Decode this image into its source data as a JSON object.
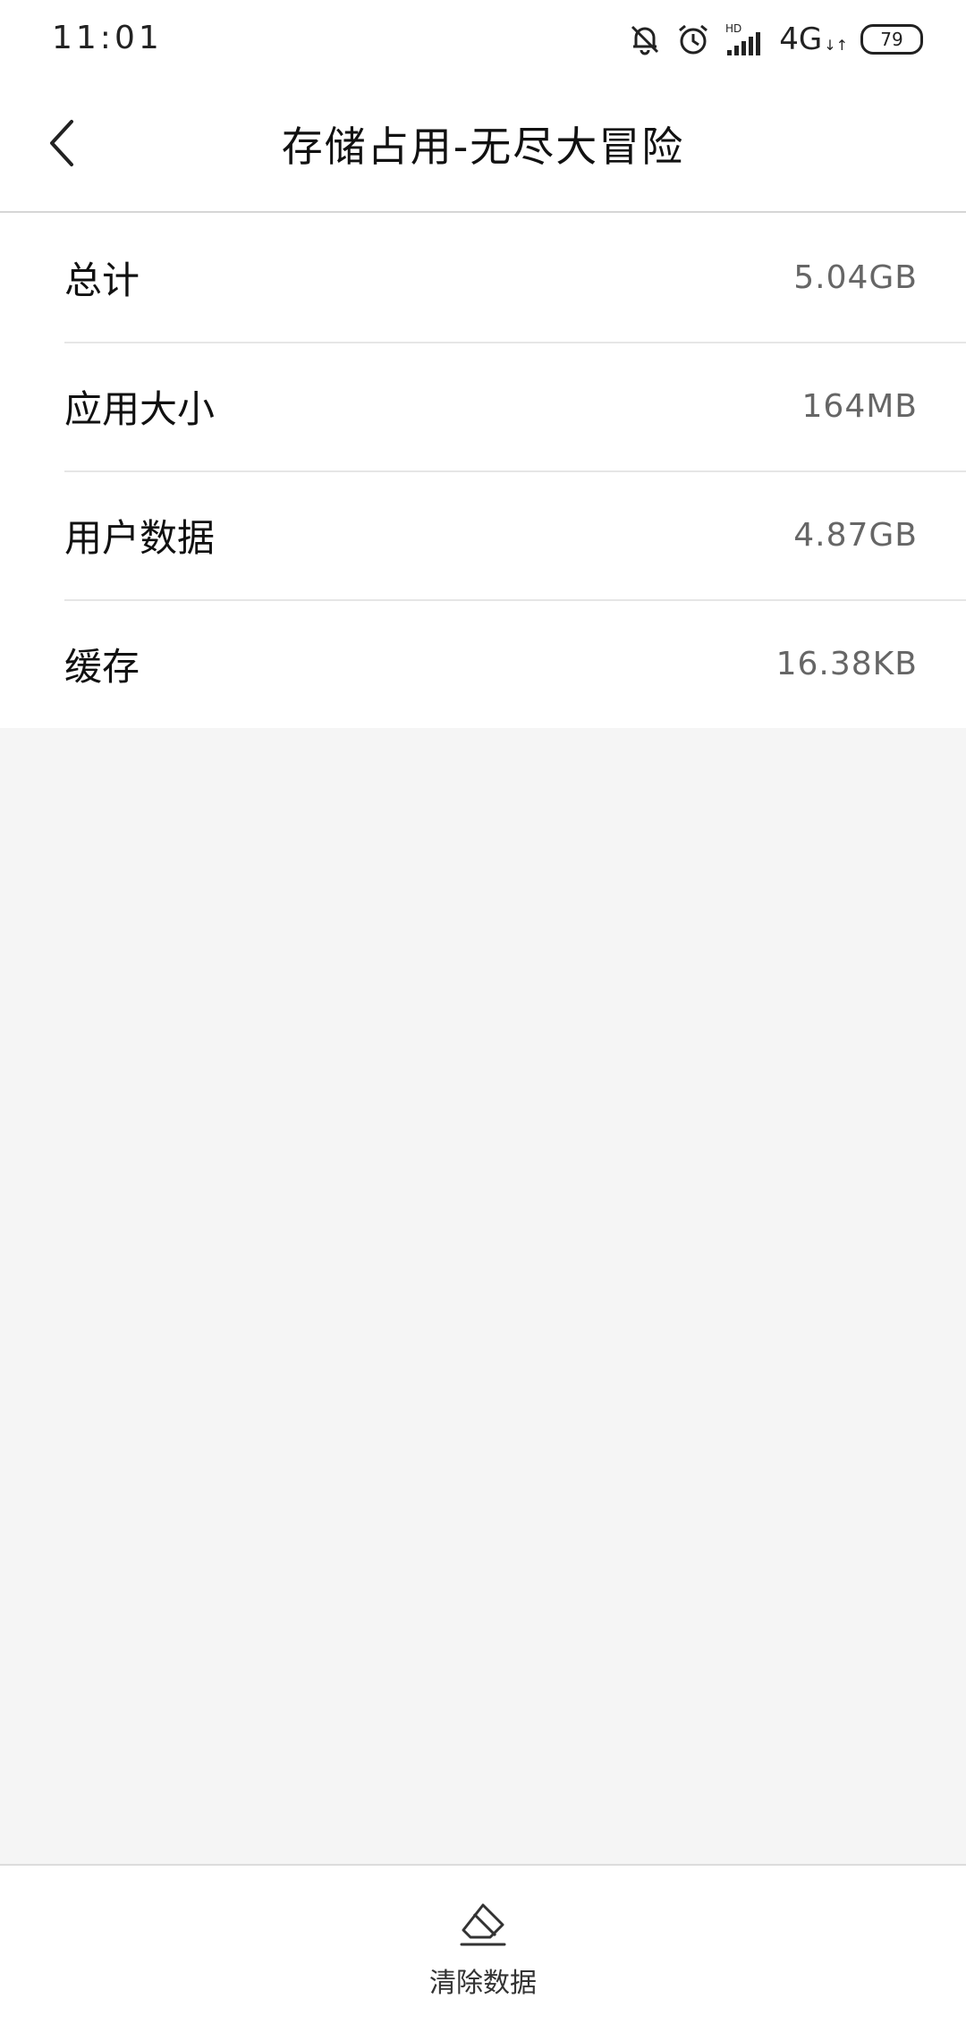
{
  "status_bar": {
    "time": "11:01",
    "hd_label": "HD",
    "network": "4G",
    "network_suffix": "↓↑",
    "battery": "79",
    "icons": [
      "mute-bell-icon",
      "alarm-icon",
      "signal-icon",
      "battery-icon"
    ]
  },
  "header": {
    "title": "存储占用-无尽大冒险",
    "back_icon": "chevron-left-icon"
  },
  "storage": {
    "rows": [
      {
        "label": "总计",
        "value": "5.04GB"
      },
      {
        "label": "应用大小",
        "value": "164MB"
      },
      {
        "label": "用户数据",
        "value": "4.87GB"
      },
      {
        "label": "缓存",
        "value": "16.38KB"
      }
    ]
  },
  "bottom": {
    "clear_label": "清除数据",
    "clear_icon": "eraser-icon"
  },
  "colors": {
    "background": "#f5f5f5",
    "surface": "#ffffff",
    "text": "#111111",
    "value_text": "#666666",
    "divider": "#e6e6e6"
  }
}
